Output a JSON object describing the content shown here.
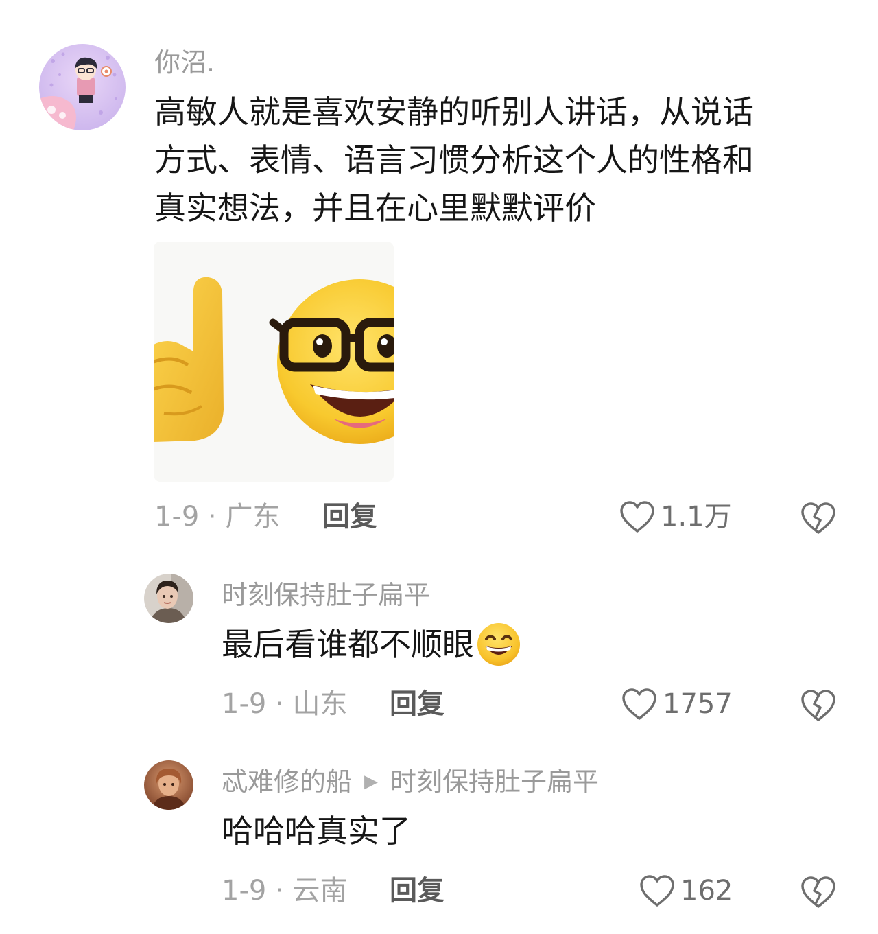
{
  "comments": [
    {
      "username": "你沼.",
      "text_lines": [
        "高敏人就是喜欢安静的听别人讲话，从说话",
        "方式、表情、语言习惯分析这个人的性格和",
        "真实想法，并且在心里默默评价"
      ],
      "meta": "1-9 · 广东",
      "reply_label": "回复",
      "like_count": "1.1万",
      "sticker": "pointing-finger-nerd-face-sticker"
    },
    {
      "username": "时刻保持肚子扁平",
      "text": "最后看谁都不顺眼",
      "emoji": "grinning-emoji",
      "meta": "1-9 · 山东",
      "reply_label": "回复",
      "like_count": "1757"
    },
    {
      "username": "忒难修的船",
      "reply_to": "时刻保持肚子扁平",
      "text": "哈哈哈真实了",
      "meta": "1-9 · 云南",
      "reply_label": "回复",
      "like_count": "162"
    }
  ],
  "colors": {
    "text": "#161616",
    "username": "#9a9a9a",
    "meta": "#a3a3a3",
    "icon": "#6e6e6e"
  }
}
